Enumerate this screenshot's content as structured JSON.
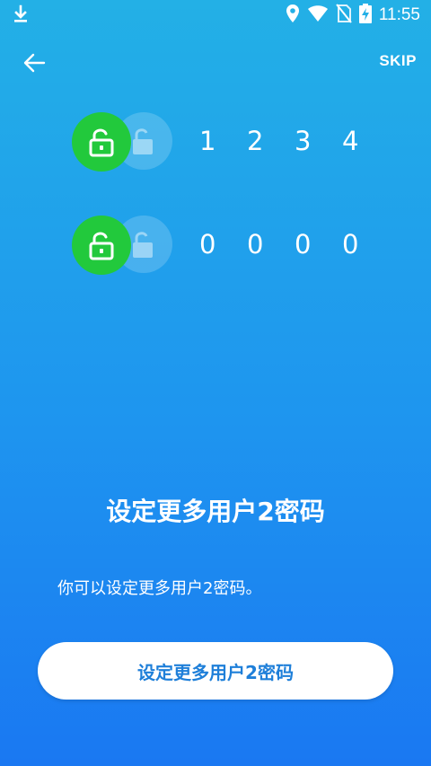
{
  "status_bar": {
    "time": "11:55",
    "icons": [
      "download-icon",
      "location-icon",
      "wifi-icon",
      "no-sim-icon",
      "battery-charging-icon"
    ]
  },
  "toolbar": {
    "back_icon": "arrow-left-icon",
    "skip_label": "SKIP"
  },
  "password_rows": [
    {
      "icon": "unlocked-padlock-icon",
      "digits": [
        "1",
        "2",
        "3",
        "4"
      ]
    },
    {
      "icon": "unlocked-padlock-icon",
      "digits": [
        "0",
        "0",
        "0",
        "0"
      ]
    }
  ],
  "main": {
    "title": "设定更多用户2密码",
    "description": "你可以设定更多用户2密码。",
    "button_label": "设定更多用户2密码"
  },
  "colors": {
    "background_top": "#23b0e6",
    "background_bottom": "#1a78f2",
    "lock_green": "#22c93c",
    "button_text": "#1e7fd9"
  }
}
